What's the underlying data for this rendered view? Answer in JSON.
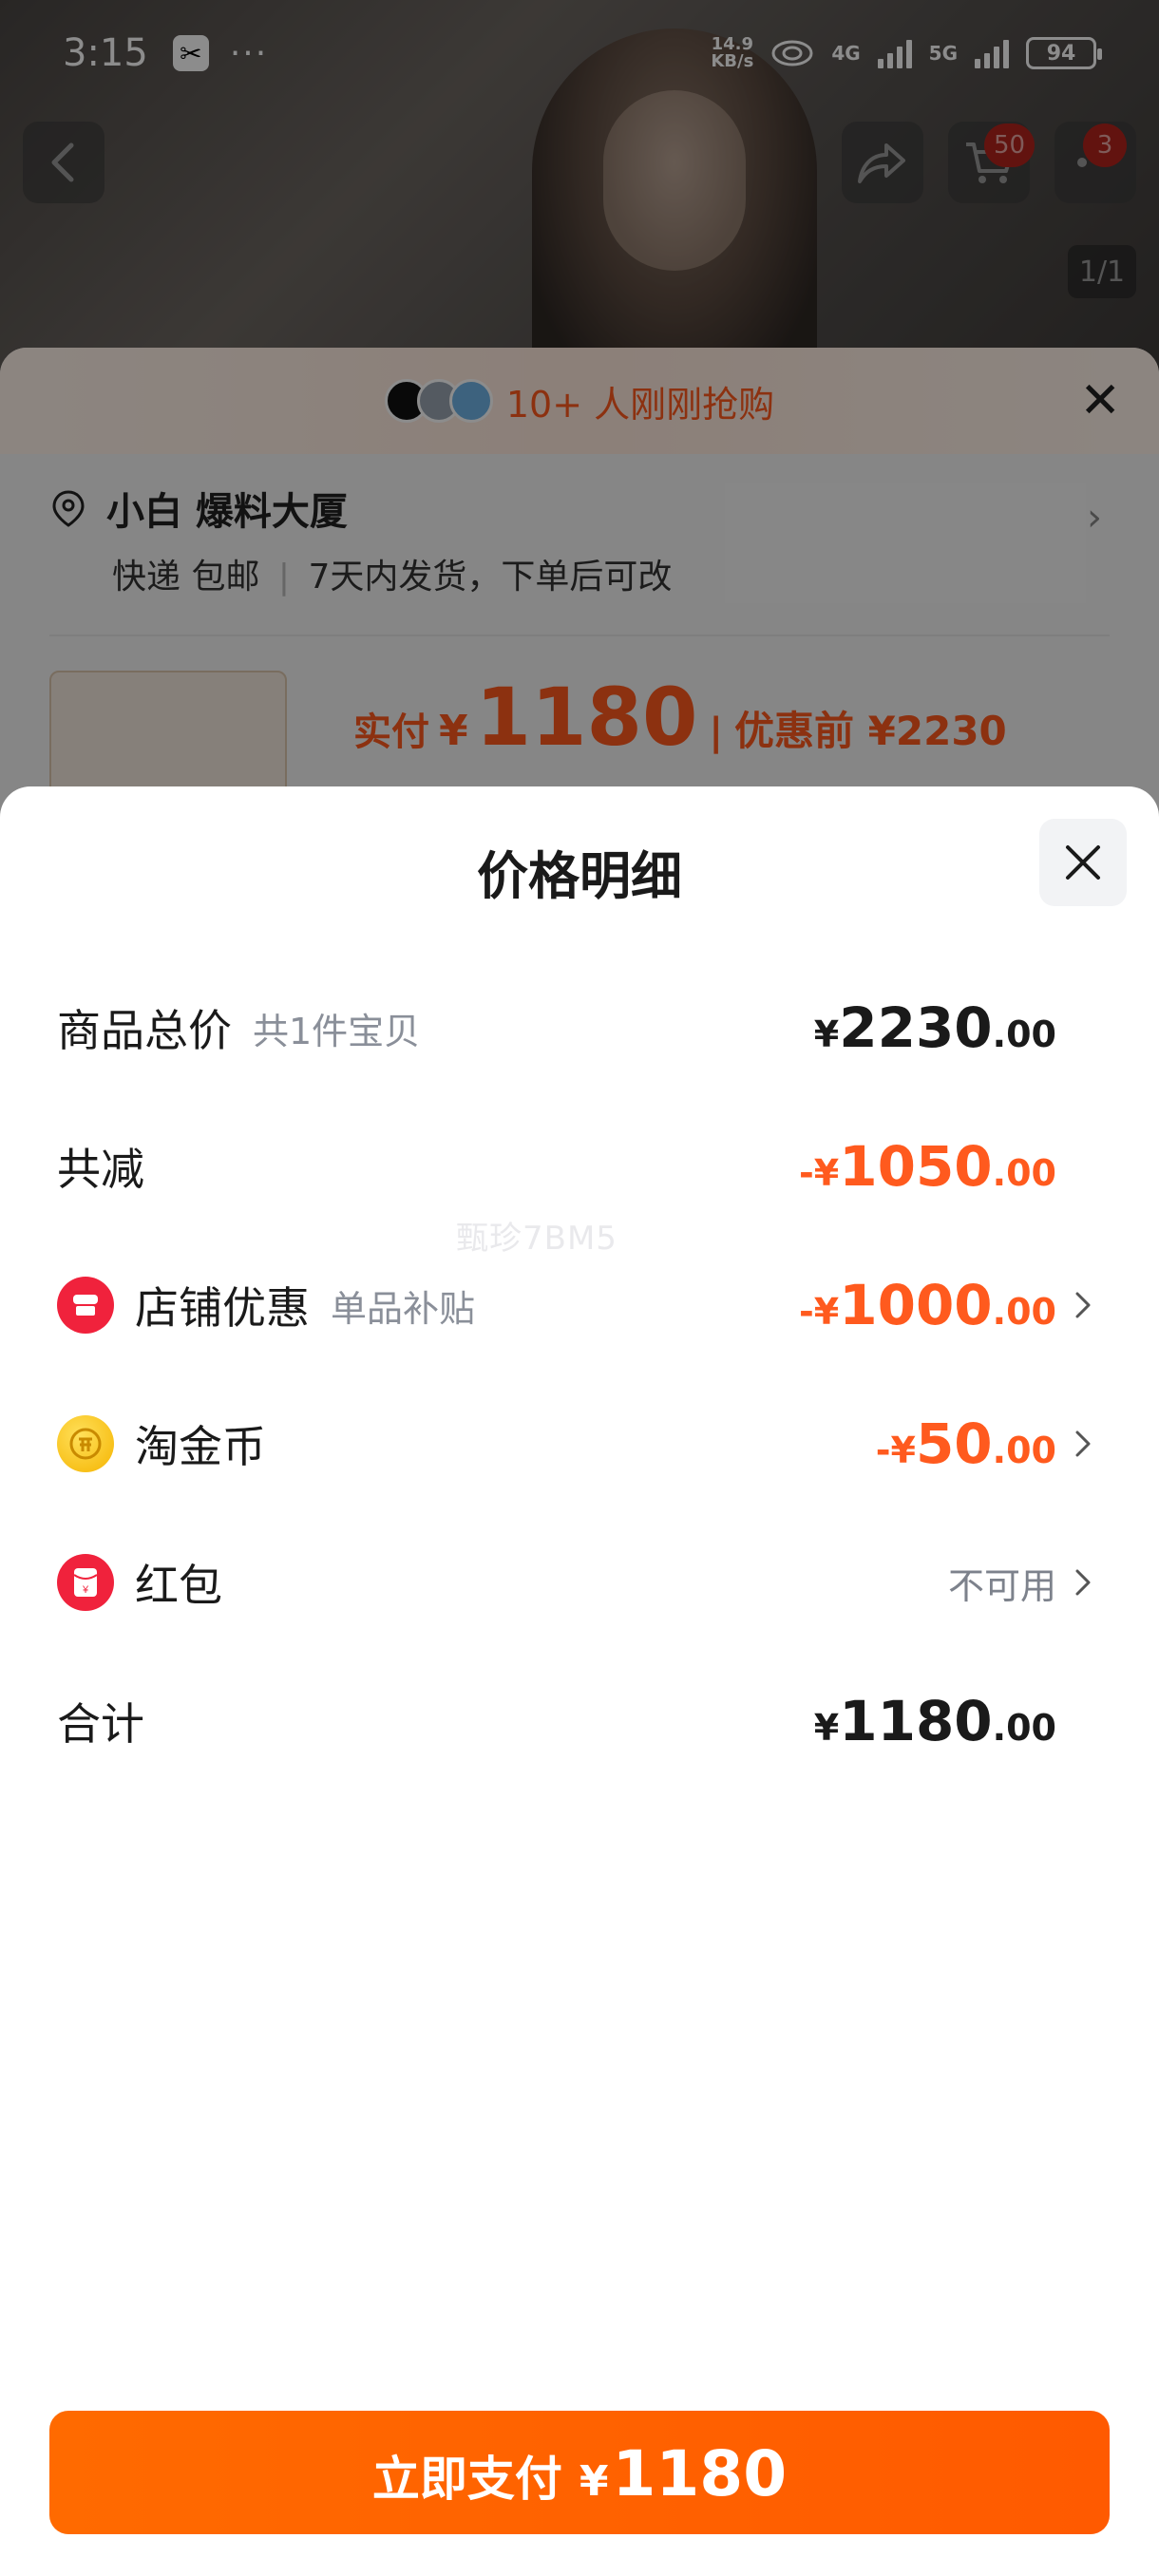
{
  "status_bar": {
    "time": "3:15",
    "app_icon": "capcut-icon",
    "more": "···",
    "net_speed_value": "14.9",
    "net_speed_unit": "KB/s",
    "net_4g": "4G",
    "net_5g": "5G",
    "battery": "94"
  },
  "background_page": {
    "cart_badge": "50",
    "message_badge": "3",
    "image_counter": "1/1",
    "banner_text": "10+ 人刚刚抢购",
    "address": "小白 爆料大厦",
    "shipping": "快递 包邮",
    "shipping_note": "7天内发货，下单后可改",
    "paid_label": "实付",
    "paid_yen": "¥",
    "paid_amount": "1180",
    "separator": "|",
    "before_discount": "优惠前 ¥2230"
  },
  "sheet": {
    "title": "价格明细",
    "watermark": "甄珍7BM5",
    "rows": {
      "total": {
        "label": "商品总价",
        "sub": "共1件宝贝",
        "yen": "¥",
        "int": "2230",
        "dec": ".00"
      },
      "reduction": {
        "label": "共减",
        "yen": "-¥",
        "int": "1050",
        "dec": ".00"
      },
      "shop_discount": {
        "label": "店铺优惠",
        "sub": "单品补贴",
        "yen": "-¥",
        "int": "1000",
        "dec": ".00"
      },
      "coins": {
        "label": "淘金币",
        "yen": "-¥",
        "int": "50",
        "dec": ".00"
      },
      "red_packet": {
        "label": "红包",
        "status": "不可用"
      },
      "sum": {
        "label": "合计",
        "yen": "¥",
        "int": "1180",
        "dec": ".00"
      }
    }
  },
  "pay_button": {
    "label": "立即支付",
    "yen": "¥",
    "amount": "1180"
  },
  "colors": {
    "accent": "#ff5a1e",
    "button": "#ff6a00",
    "text": "#1a1a1a",
    "muted": "#8a8f99"
  }
}
